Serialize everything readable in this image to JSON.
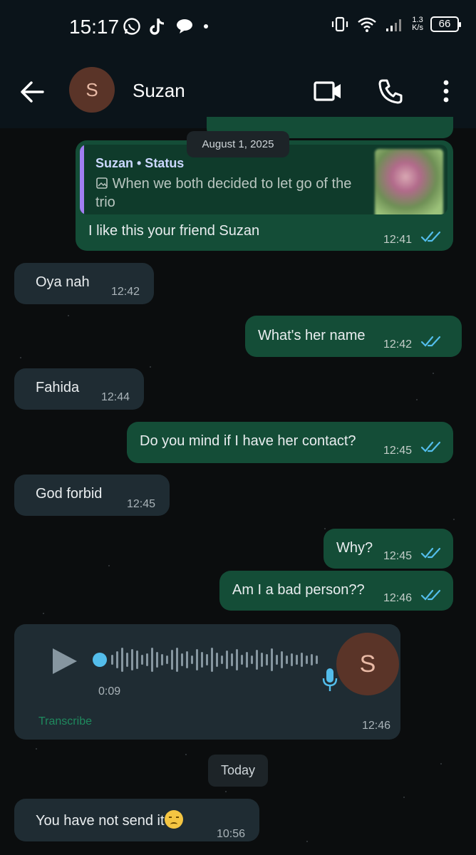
{
  "status_bar": {
    "time": "15:17",
    "speed_value": "1.3",
    "speed_unit": "K/s",
    "battery": "66"
  },
  "header": {
    "avatar_initial": "S",
    "contact_name": "Suzan"
  },
  "date_chips": {
    "first": "August 1, 2025",
    "second": "Today"
  },
  "messages": [
    {
      "direction": "out",
      "quote_author": "Suzan • Status",
      "quote_text": "When we both decided to let go of the trio",
      "text": "I like this your friend Suzan",
      "time": "12:41",
      "read": true
    },
    {
      "direction": "in",
      "text": "Oya nah",
      "time": "12:42"
    },
    {
      "direction": "out",
      "text": "What's her name",
      "time": "12:42",
      "read": true
    },
    {
      "direction": "in",
      "text": "Fahida",
      "time": "12:44"
    },
    {
      "direction": "out",
      "text": "Do you mind if I have her contact?",
      "time": "12:45",
      "read": true
    },
    {
      "direction": "in",
      "text": "God forbid",
      "time": "12:45"
    },
    {
      "direction": "out",
      "text": "Why?",
      "time": "12:45",
      "read": true
    },
    {
      "direction": "out",
      "text": "Am I a bad person??",
      "time": "12:46",
      "read": true
    },
    {
      "direction": "in",
      "text": "You have not send it",
      "time": "10:56"
    }
  ],
  "voice_note": {
    "duration": "0:09",
    "transcribe_label": "Transcribe",
    "time": "12:46",
    "avatar_initial": "S"
  },
  "colors": {
    "incoming_bubble": "#1f2c33",
    "outgoing_bubble": "#144d37",
    "read_ticks": "#53bdeb"
  }
}
